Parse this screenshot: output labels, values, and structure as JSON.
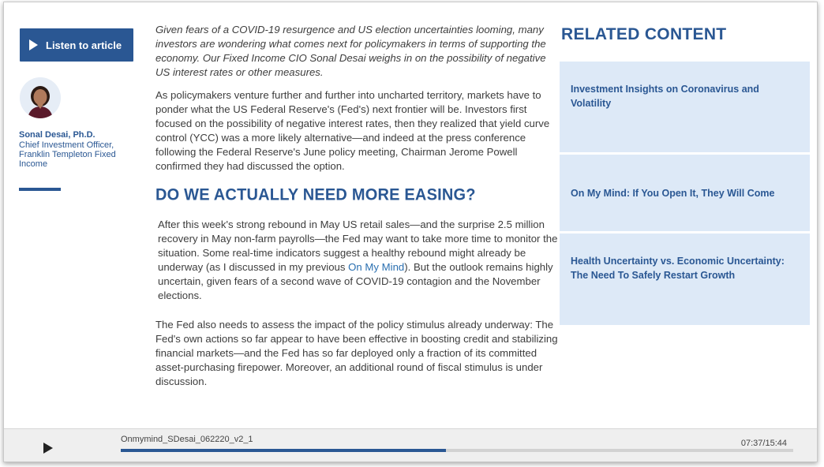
{
  "author": {
    "listen_label": "Listen to article",
    "name": "Sonal Desai, Ph.D.",
    "title": "Chief Investment Officer, Franklin Templeton Fixed Income"
  },
  "article": {
    "intro": "Given fears of a COVID-19 resurgence and US election uncertainties looming, many investors are wondering what comes next for policymakers in terms of supporting the economy. Our Fixed Income CIO Sonal Desai weighs in on the possibility of negative US interest rates or other measures.",
    "para1": "As policymakers venture further and further into uncharted territory, markets have to ponder what the US Federal Reserve's (Fed's) next frontier will be. Investors first focused on the possibility of negative interest rates, then they realized that yield curve control (YCC) was a more likely alternative—and indeed at the press conference following the Federal Reserve's June policy meeting, Chairman Jerome Powell confirmed they had discussed the option.",
    "heading": "DO WE ACTUALLY NEED MORE EASING?",
    "para2_before": "After this week's strong rebound in May US retail sales—and the surprise 2.5 million recovery in May non-farm payrolls—the Fed may want to take more time to monitor the situation. Some real-time indicators suggest a healthy rebound might already be underway (as I discussed in my previous ",
    "para2_link": "On My Mind",
    "para2_after": "). But the outlook remains highly uncertain, given fears of a second wave of COVID-19 contagion and the November elections.",
    "para3": "The Fed also needs to assess the impact of the policy stimulus already underway: The Fed's own actions so far appear to have been effective in boosting credit and stabilizing financial markets—and the Fed has so far deployed only a fraction of its committed asset-purchasing firepower. Moreover, an additional round of fiscal stimulus is under discussion."
  },
  "related": {
    "heading": "RELATED CONTENT",
    "items": [
      {
        "label": "Investment Insights on Coronavirus and Volatility"
      },
      {
        "label": "On My Mind: If You Open It, They Will Come"
      },
      {
        "label": "Health Uncertainty vs. Economic Uncertainty: The Need To Safely Restart Growth"
      }
    ]
  },
  "player": {
    "track_name": "Onmymind_SDesai_062220_v2_1",
    "time": "07:37/15:44",
    "progress_fraction": 0.484
  },
  "colors": {
    "brand_blue": "#2a5793",
    "link_blue": "#2a6fb0",
    "card_bg": "#dde9f7"
  }
}
